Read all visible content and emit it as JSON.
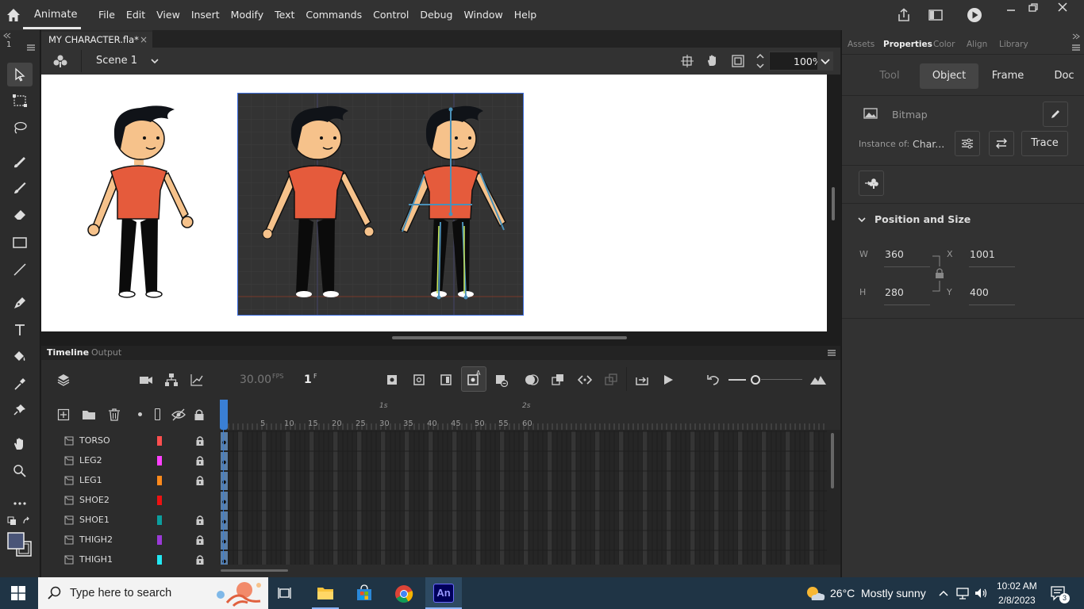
{
  "app": {
    "name": "Animate",
    "menus": [
      "File",
      "Edit",
      "View",
      "Insert",
      "Modify",
      "Text",
      "Commands",
      "Control",
      "Debug",
      "Window",
      "Help"
    ]
  },
  "document": {
    "tab_title": "MY CHARACTER.fla*",
    "scene": "Scene 1",
    "zoom": "100%"
  },
  "toolbar_side": {
    "top_left": "1"
  },
  "timeline": {
    "tabs": [
      "Timeline",
      "Output"
    ],
    "fps": "30.00",
    "fps_unit": "FPS",
    "current_frame": "1",
    "frame_unit": "F",
    "ruler_seconds": [
      "1s",
      "2s"
    ],
    "ruler_numbers": [
      "5",
      "10",
      "15",
      "20",
      "25",
      "30",
      "35",
      "40",
      "45",
      "50",
      "55",
      "60"
    ],
    "layers": [
      {
        "name": "TORSO",
        "color": "#ff4f4f",
        "locked": true
      },
      {
        "name": "LEG2",
        "color": "#ff40ff",
        "locked": true
      },
      {
        "name": "LEG1",
        "color": "#ff8a1c",
        "locked": true
      },
      {
        "name": "SHOE2",
        "color": "#ee1111",
        "locked": false
      },
      {
        "name": "SHOE1",
        "color": "#0b9e9e",
        "locked": true
      },
      {
        "name": "THIGH2",
        "color": "#9b3ad8",
        "locked": true
      },
      {
        "name": "THIGH1",
        "color": "#22e7f2",
        "locked": true
      }
    ]
  },
  "properties": {
    "panel_tabs": [
      "Assets",
      "Properties",
      "Color",
      "Align",
      "Library"
    ],
    "segments": [
      "Tool",
      "Object",
      "Frame",
      "Doc"
    ],
    "selected_segment": "Object",
    "object_type": "Bitmap",
    "instance_of_label": "Instance of:",
    "instance_of_value": "Char...",
    "trace_label": "Trace",
    "section_title": "Position and Size",
    "w_label": "W",
    "w_value": "360",
    "h_label": "H",
    "h_value": "280",
    "x_label": "X",
    "x_value": "1001",
    "y_label": "Y",
    "y_value": "400"
  },
  "taskbar": {
    "search_placeholder": "Type here to search",
    "weather_temp": "26°C",
    "weather_desc": "Mostly sunny",
    "time": "10:02 AM",
    "date": "2/8/2023",
    "notifications": "3",
    "active_app": "An"
  }
}
